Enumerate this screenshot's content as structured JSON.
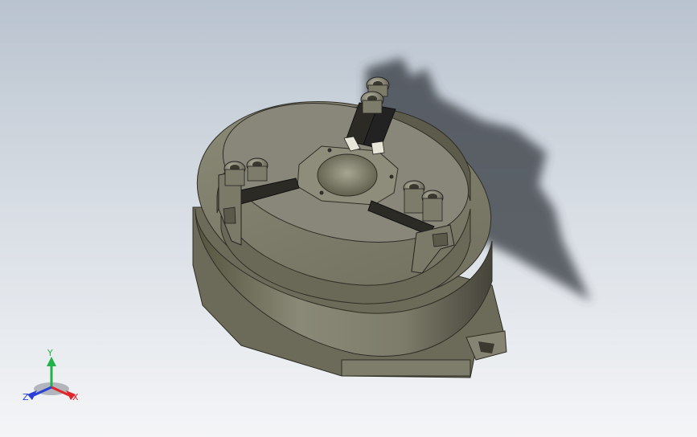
{
  "viewport": {
    "background_top": "#b9c3cf",
    "background_bottom": "#f4f5f7"
  },
  "model": {
    "body_color": "#7b7a6a",
    "body_dark": "#4b4a3e",
    "body_light": "#9a9985",
    "shadow_color": "#3e4248",
    "jaw_count": 3,
    "bolts_per_jaw": 2
  },
  "triad": {
    "x_label": "X",
    "y_label": "Y",
    "z_label": "Z",
    "x_color": "#e0262a",
    "y_color": "#22b24a",
    "z_color": "#2a3fd6"
  }
}
